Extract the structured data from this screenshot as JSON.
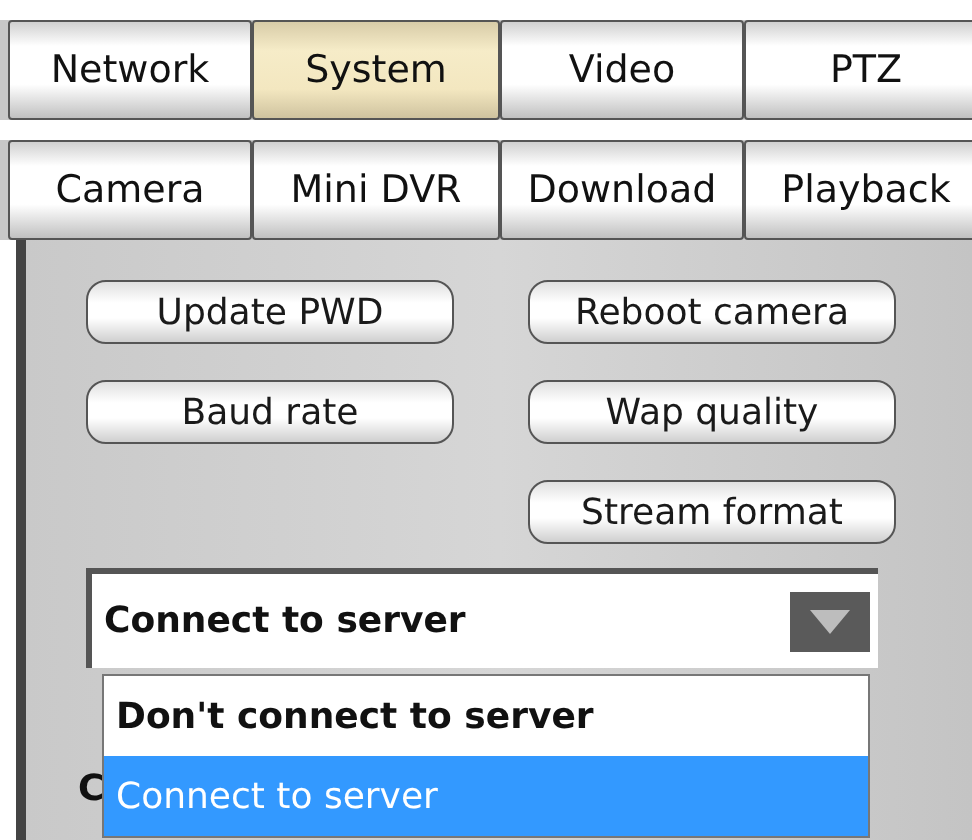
{
  "main_tabs": [
    {
      "label": "Network",
      "selected": false
    },
    {
      "label": "System",
      "selected": true
    },
    {
      "label": "Video",
      "selected": false
    },
    {
      "label": "PTZ",
      "selected": false
    }
  ],
  "sub_tabs": [
    {
      "label": "Camera"
    },
    {
      "label": "Mini DVR"
    },
    {
      "label": "Download"
    },
    {
      "label": "Playback"
    }
  ],
  "left_buttons": [
    "Update PWD",
    "Baud rate"
  ],
  "right_buttons": [
    "Reboot camera",
    "Wap quality",
    "Stream format"
  ],
  "server_select": {
    "value": "Connect to server",
    "expanded": true,
    "options": [
      {
        "label": "Don't connect to server",
        "selected": false
      },
      {
        "label": "Connect to server",
        "selected": true
      }
    ]
  },
  "hidden_label": "C"
}
